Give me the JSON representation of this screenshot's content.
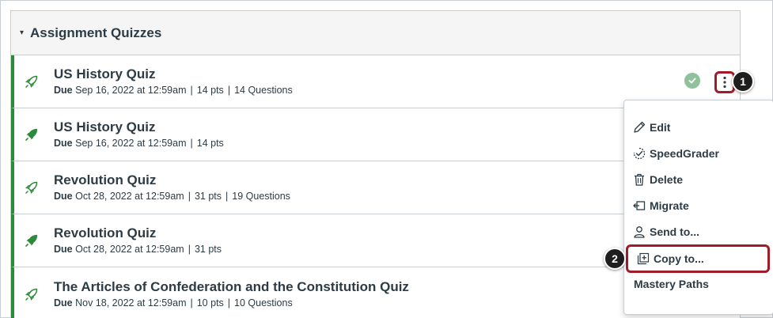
{
  "module": {
    "header": "Assignment Quizzes",
    "caret": "▾"
  },
  "quizzes": [
    {
      "title": "US History Quiz",
      "due_label": "Due",
      "due": "Sep 16, 2022 at 12:59am",
      "points": "14 pts",
      "questions": "14 Questions",
      "icon": "classic-quiz-rocket-icon"
    },
    {
      "title": "US History Quiz",
      "due_label": "Due",
      "due": "Sep 16, 2022 at 12:59am",
      "points": "14 pts",
      "questions": "",
      "icon": "new-quiz-rocket-icon"
    },
    {
      "title": "Revolution Quiz",
      "due_label": "Due",
      "due": "Oct 28, 2022 at 12:59am",
      "points": "31 pts",
      "questions": "19 Questions",
      "icon": "classic-quiz-rocket-icon"
    },
    {
      "title": "Revolution Quiz",
      "due_label": "Due",
      "due": "Oct 28, 2022 at 12:59am",
      "points": "31 pts",
      "questions": "",
      "icon": "new-quiz-rocket-icon"
    },
    {
      "title": "The Articles of Confederation and the Constitution Quiz",
      "due_label": "Due",
      "due": "Nov 18, 2022 at 12:59am",
      "points": "10 pts",
      "questions": "10 Questions",
      "icon": "classic-quiz-rocket-icon"
    }
  ],
  "separator": "|",
  "menu": {
    "items": [
      {
        "label": "Edit",
        "icon": "pencil-icon"
      },
      {
        "label": "SpeedGrader",
        "icon": "speedgrader-icon"
      },
      {
        "label": "Delete",
        "icon": "trash-icon"
      },
      {
        "label": "Migrate",
        "icon": "migrate-icon"
      },
      {
        "label": "Send to...",
        "icon": "send-to-user-icon"
      },
      {
        "label": "Copy to...",
        "icon": "copy-to-icon"
      },
      {
        "label": "Mastery Paths",
        "icon": ""
      }
    ]
  },
  "callouts": {
    "first": "1",
    "second": "2"
  },
  "colors": {
    "accent_green": "#2c8a3a",
    "published_check": "#8fc19a",
    "highlight_red": "#a11c28",
    "text": "#2d3b45"
  }
}
